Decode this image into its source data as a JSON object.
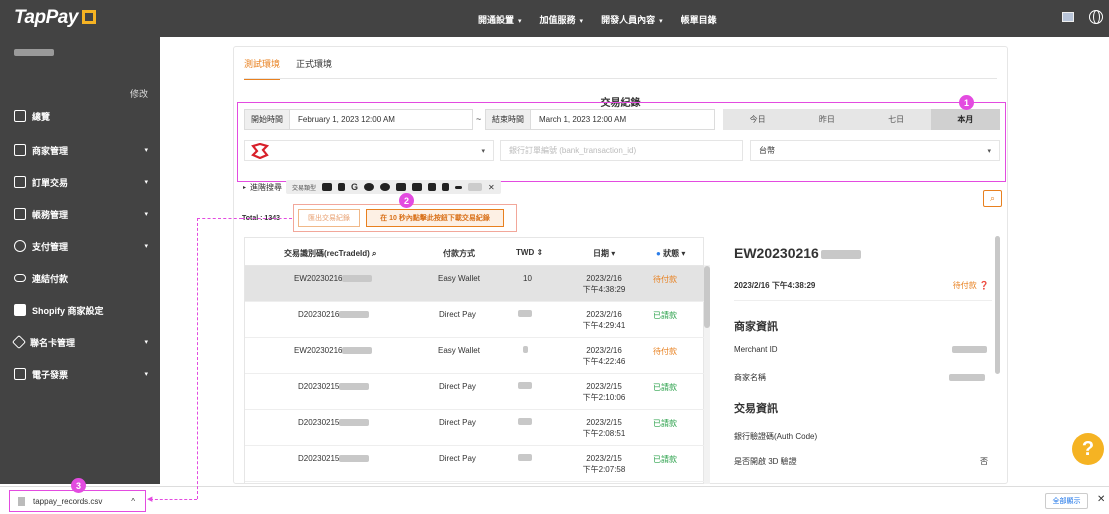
{
  "topbar": {
    "logo": "TapPay",
    "nav": [
      "開通設置",
      "加值服務",
      "開發人員內容",
      "帳單目錄"
    ]
  },
  "sidebar": {
    "edit_label": "修改",
    "items": [
      {
        "label": "總覽",
        "icon": "grid-icon"
      },
      {
        "label": "商家管理",
        "icon": "store-icon"
      },
      {
        "label": "訂單交易",
        "icon": "transaction-icon"
      },
      {
        "label": "帳務管理",
        "icon": "bank-icon"
      },
      {
        "label": "支付管理",
        "icon": "payment-icon"
      },
      {
        "label": "連結付款",
        "icon": "link-icon"
      },
      {
        "label": "Shopify 商家設定",
        "icon": "shopify-bag-icon"
      },
      {
        "label": "聯名卡管理",
        "icon": "card-icon"
      },
      {
        "label": "電子發票",
        "icon": "invoice-icon"
      }
    ]
  },
  "tabs": [
    "測試環境",
    "正式環境"
  ],
  "section_title": "交易紀錄",
  "filters": {
    "start_label": "開始時間",
    "start_value": "February 1, 2023 12:00 AM",
    "tilde": "~",
    "end_label": "結束時間",
    "end_value": "March 1, 2023 12:00 AM",
    "ranges": [
      "今日",
      "昨日",
      "七日",
      "本月"
    ],
    "selected_range": "本月",
    "bank_placeholder": "銀行訂單編號 (bank_transaction_id)",
    "currency": "台幣"
  },
  "advanced_label": "進階搜尋",
  "payment_type_label": "交易類型",
  "total_label": "Total : 1343",
  "export_button": "匯出交易紀錄",
  "export_notice_button": "在 10 秒內點擊此按鈕下載交易紀錄",
  "table": {
    "headers": [
      "交易識別碼(recTradeId)",
      "付款方式",
      "TWD",
      "日期",
      "狀態"
    ],
    "rows": [
      {
        "id": "EW20230216",
        "method": "Easy Wallet",
        "amount": "10",
        "date": "2023/2/16",
        "time": "下午4:38:29",
        "status": "待付款",
        "status_type": "pending"
      },
      {
        "id": "D20230216",
        "method": "Direct Pay",
        "amount": "",
        "date": "2023/2/16",
        "time": "下午4:29:41",
        "status": "已請款",
        "status_type": "ok"
      },
      {
        "id": "EW20230216",
        "method": "Easy Wallet",
        "amount": "",
        "date": "2023/2/16",
        "time": "下午4:22:46",
        "status": "待付款",
        "status_type": "pending"
      },
      {
        "id": "D20230215",
        "method": "Direct Pay",
        "amount": "",
        "date": "2023/2/15",
        "time": "下午2:10:06",
        "status": "已請款",
        "status_type": "ok"
      },
      {
        "id": "D20230215",
        "method": "Direct Pay",
        "amount": "",
        "date": "2023/2/15",
        "time": "下午2:08:51",
        "status": "已請款",
        "status_type": "ok"
      },
      {
        "id": "D20230215",
        "method": "Direct Pay",
        "amount": "",
        "date": "2023/2/15",
        "time": "下午2:07:58",
        "status": "已請款",
        "status_type": "ok"
      }
    ]
  },
  "detail": {
    "title": "EW20230216",
    "datetime": "2023/2/16 下午4:38:29",
    "status": "待付款",
    "merchant_heading": "商家資訊",
    "merchant_id_label": "Merchant ID",
    "merchant_name_label": "商家名稱",
    "trade_heading": "交易資訊",
    "auth_code_label": "銀行驗證碼(Auth Code)",
    "three_d_label": "是否開啟 3D 驗證",
    "three_d_value": "否"
  },
  "download_bar": {
    "file_name": "tappay_records.csv",
    "show_all": "全部顯示"
  },
  "badges": [
    "1",
    "2",
    "3"
  ],
  "colors": {
    "accent": "#e8801f",
    "highlight": "#e34be0",
    "success": "#2ba14b",
    "topbar": "#434343"
  }
}
